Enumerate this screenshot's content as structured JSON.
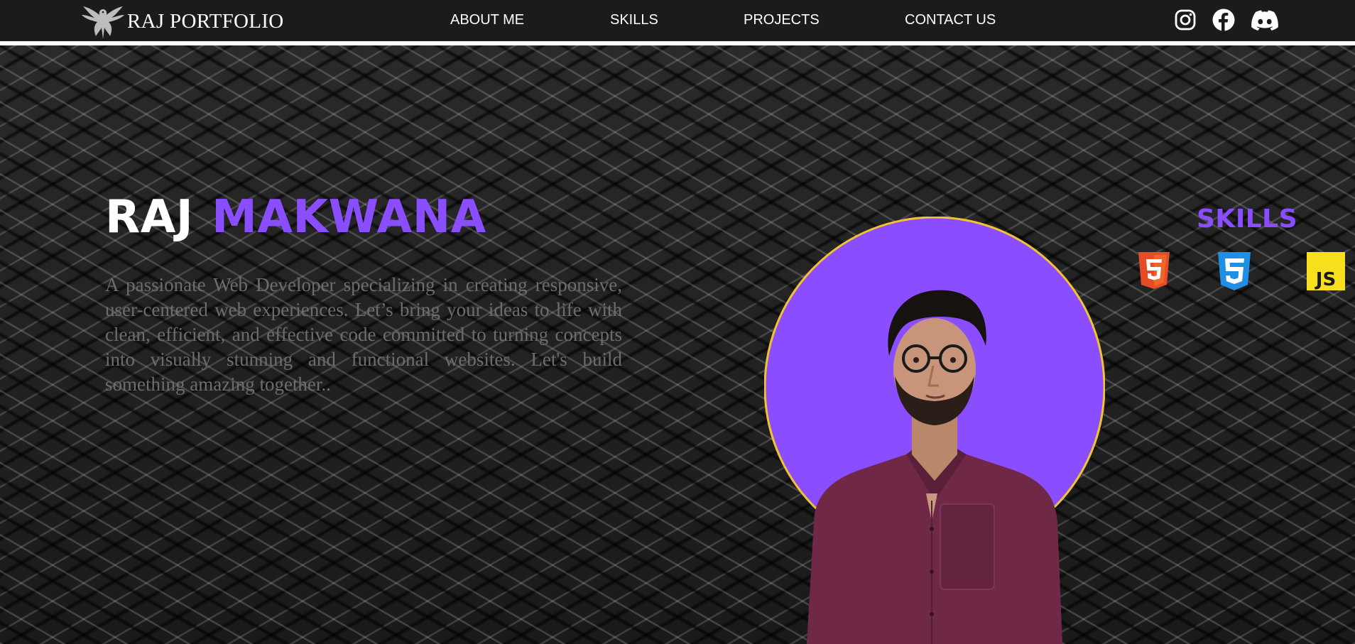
{
  "nav": {
    "brand": "RAJ PORTFOLIO",
    "links": [
      "ABOUT ME",
      "SKILLS",
      "PROJECTS",
      "CONTACT US"
    ]
  },
  "social": {
    "icons": [
      "instagram-icon",
      "facebook-icon",
      "discord-icon"
    ]
  },
  "hero": {
    "first_name": "RAJ",
    "last_name": "MAKWANA",
    "bio": "A passionate Web Developer specializing in creating responsive, user-centered web experiences. Let’s bring your ideas to life with clean, efficient, and effective code committed to turning concepts into visually stunning and functional websites. Let's build something amazing together.."
  },
  "skills": {
    "title": "SKILLS",
    "icons": [
      "html5-icon",
      "css3-icon",
      "javascript-icon"
    ]
  },
  "colors": {
    "accent": "#8a4dff",
    "nav_bg": "#1b1b1b",
    "portrait_ring": "#f2c230",
    "html5": "#e44d26",
    "css3": "#1f8fe5",
    "javascript": "#f7df1e"
  }
}
